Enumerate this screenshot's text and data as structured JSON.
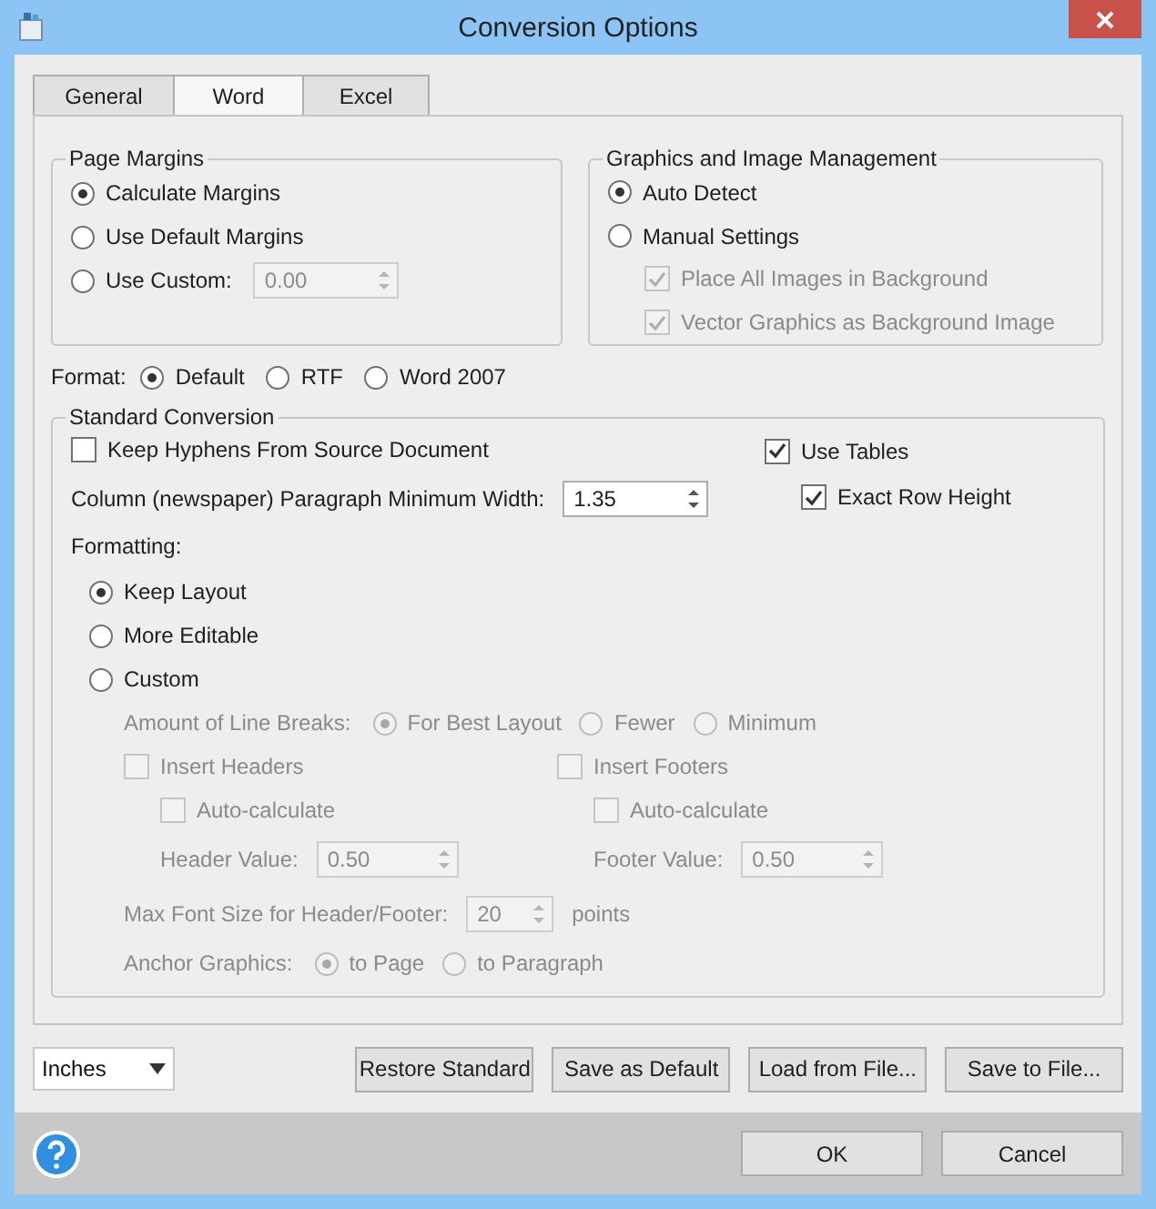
{
  "window": {
    "title": "Conversion Options"
  },
  "tabs": [
    {
      "label": "General",
      "selected": false
    },
    {
      "label": "Word",
      "selected": true
    },
    {
      "label": "Excel",
      "selected": false
    }
  ],
  "page_margins": {
    "title": "Page Margins",
    "options": [
      {
        "label": "Calculate Margins",
        "selected": true
      },
      {
        "label": "Use Default Margins",
        "selected": false
      },
      {
        "label": "Use Custom:",
        "selected": false
      }
    ],
    "custom": {
      "value": "0.00",
      "disabled": true
    }
  },
  "graphics": {
    "title": "Graphics and Image Management",
    "options": [
      {
        "label": "Auto Detect",
        "selected": true
      },
      {
        "label": "Manual Settings",
        "selected": false
      }
    ],
    "checks": [
      {
        "label": "Place All Images in Background",
        "checked": true,
        "disabled": true
      },
      {
        "label": "Vector Graphics as Background Image",
        "checked": true,
        "disabled": true
      }
    ]
  },
  "format": {
    "label": "Format:",
    "options": [
      {
        "label": "Default",
        "selected": true
      },
      {
        "label": "RTF",
        "selected": false
      },
      {
        "label": "Word 2007",
        "selected": false
      }
    ]
  },
  "standard": {
    "title": "Standard Conversion",
    "keep_hyphens": {
      "label": "Keep Hyphens From Source Document",
      "checked": false,
      "disabled": false
    },
    "use_tables": {
      "label": "Use Tables",
      "checked": true,
      "disabled": false
    },
    "exact_row_height": {
      "label": "Exact Row Height",
      "checked": true,
      "disabled": false
    },
    "column_width": {
      "label": "Column (newspaper) Paragraph Minimum Width:",
      "value": "1.35",
      "disabled": false
    },
    "formatting": {
      "label": "Formatting:",
      "options": [
        {
          "label": "Keep Layout",
          "selected": true
        },
        {
          "label": "More Editable",
          "selected": false
        },
        {
          "label": "Custom",
          "selected": false
        }
      ]
    },
    "line_breaks": {
      "label": "Amount of Line Breaks:",
      "disabled": true,
      "options": [
        {
          "label": "For Best Layout",
          "selected": true
        },
        {
          "label": "Fewer",
          "selected": false
        },
        {
          "label": "Minimum",
          "selected": false
        }
      ]
    },
    "headers": {
      "insert": {
        "label": "Insert Headers",
        "checked": false,
        "disabled": true
      },
      "auto": {
        "label": "Auto-calculate",
        "checked": false,
        "disabled": true
      },
      "value_label": "Header Value:",
      "value": "0.50"
    },
    "footers": {
      "insert": {
        "label": "Insert Footers",
        "checked": false,
        "disabled": true
      },
      "auto": {
        "label": "Auto-calculate",
        "checked": false,
        "disabled": true
      },
      "value_label": "Footer Value:",
      "value": "0.50"
    },
    "max_font": {
      "label": "Max Font Size for Header/Footer:",
      "value": "20",
      "unit": "points",
      "disabled": true
    },
    "anchor": {
      "label": "Anchor Graphics:",
      "disabled": true,
      "options": [
        {
          "label": "to Page",
          "selected": true
        },
        {
          "label": "to Paragraph",
          "selected": false
        }
      ]
    }
  },
  "units": {
    "value": "Inches"
  },
  "actions": [
    "Restore Standard",
    "Save as Default",
    "Load from File...",
    "Save to File..."
  ],
  "dialog_buttons": [
    "OK",
    "Cancel"
  ]
}
